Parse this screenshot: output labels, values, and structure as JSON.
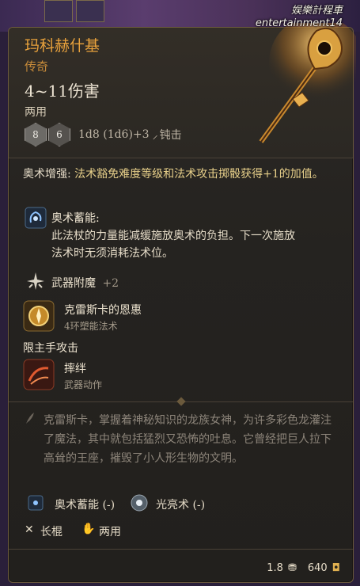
{
  "watermark": {
    "line1": "娱樂計程車",
    "line2": "entertainment14"
  },
  "item": {
    "name": "玛科赫什基",
    "rarity": "传奇",
    "damage": "4~11伤害",
    "handedness": "两用",
    "dice": [
      "8",
      "6"
    ],
    "dice_text": "1d8 (1d6)+3",
    "damage_type": "钝击"
  },
  "passive": {
    "title": "奥术增强:",
    "text": "法术豁免难度等级和法术攻击掷骰获得+1的加值。"
  },
  "arcane_charge": {
    "name": "奥术蓄能:",
    "desc_line1": "此法杖的力量能减缓施放奥术的负担。下一次施放",
    "desc_line2": "法术时无须消耗法术位。"
  },
  "weapon_enchant": {
    "label": "武器附魔",
    "value": "+2"
  },
  "spell": {
    "name": "克雷斯卡的恩惠",
    "sub": "4环塑能法术"
  },
  "main_hand_label": "限主手攻击",
  "action": {
    "name": "摔绊",
    "sub": "武器动作"
  },
  "lore": "克雷斯卡，掌握着神秘知识的龙族女神，为许多彩色龙灌注了魔法，其中就包括猛烈又恐怖的吐息。它曾经把巨人拉下高耸的王座，摧毁了小人形生物的文明。",
  "tags": [
    {
      "label": "奥术蓄能",
      "suffix": "(-)"
    },
    {
      "label": "光亮术",
      "suffix": "(-)"
    }
  ],
  "proficiency": {
    "type": "长棍",
    "hands": "两用"
  },
  "weight": "1.8",
  "value": "640",
  "colors": {
    "name": "#e9a23c",
    "rarity": "#c78b3a",
    "plus": "#a49a8a",
    "border": "#6b5a3c"
  }
}
